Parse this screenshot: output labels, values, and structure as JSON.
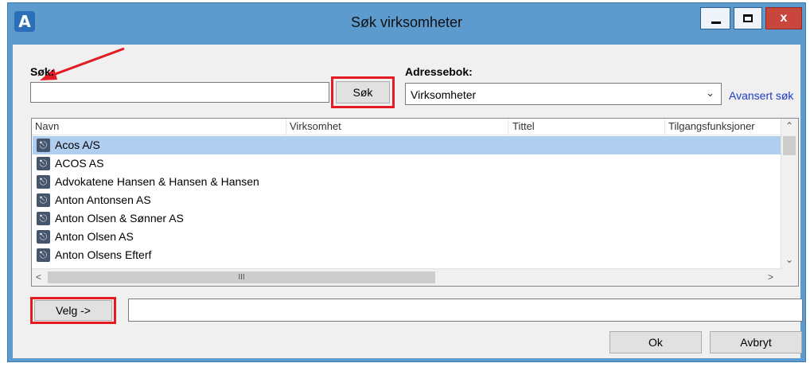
{
  "window": {
    "title": "Søk virksomheter",
    "app_icon": "A",
    "close_glyph": "x"
  },
  "search": {
    "label": "Søk:",
    "value": "",
    "button": "Søk"
  },
  "addressbook": {
    "label": "Adressebok:",
    "selected": "Virksomheter",
    "advanced_link": "Avansert søk"
  },
  "list": {
    "columns": [
      "Navn",
      "Virksomhet",
      "Tittel",
      "Tilgangsfunksjoner"
    ],
    "rows": [
      "Acos A/S",
      "ACOS AS",
      "Advokatene Hansen & Hansen & Hansen",
      "Anton Antonsen AS",
      "Anton Olsen & Sønner AS",
      "Anton Olsen AS",
      "Anton Olsens Efterf"
    ],
    "selected_row": 0,
    "scroll_thumb_glyph": "III"
  },
  "select": {
    "button": "Velg ->",
    "value": ""
  },
  "footer": {
    "ok": "Ok",
    "cancel": "Avbryt"
  },
  "colors": {
    "highlight": "#e31b23",
    "title_bar": "#5d9bcf",
    "selected_row": "#b0cff0",
    "link": "#1f39c9"
  }
}
